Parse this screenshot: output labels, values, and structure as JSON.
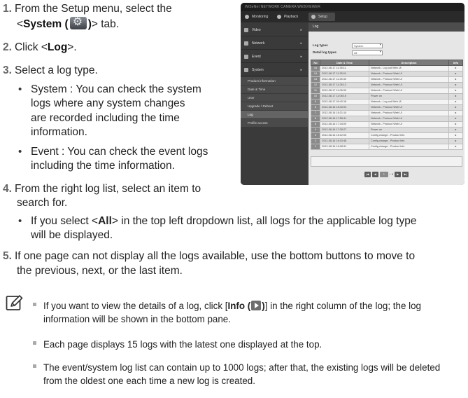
{
  "steps": [
    {
      "num": "1.",
      "line1": "From the Setup menu, select the",
      "pre": "<",
      "bold": "System (",
      "bold2": ")",
      "post": "> tab."
    },
    {
      "num": "2.",
      "pre": "Click <",
      "bold": "Log",
      "post": ">."
    },
    {
      "num": "3.",
      "text": "Select a log type."
    },
    {
      "num": "4.",
      "line1": "From the right log list, select an item to",
      "line2": "search for."
    },
    {
      "num": "5.",
      "line1": "If one page can not display all the logs available, use the bottom buttons to move to",
      "line2": "the previous, next, or the last item."
    }
  ],
  "sub_bullets": [
    {
      "l1": "System : You can check the system",
      "l2": "logs where any system changes",
      "l3": "are recorded including the time",
      "l4": "information."
    },
    {
      "l1": "Event : You can check the event logs",
      "l2": "including the time information."
    },
    {
      "pre": "If you select <",
      "bold": "All",
      "post": "> in the top left dropdown list, all logs for the applicable log type",
      "l2": "will be displayed."
    }
  ],
  "notes": [
    {
      "pre": "If you want to view the details of a log, click [",
      "bold": "Info (",
      "bold2": ")",
      "post": "] in the right column of the log; the log",
      "l2": "information will be shown in the bottom pane."
    },
    {
      "text": "Each page displays 15 logs with the latest one displayed at the top."
    },
    {
      "l1": "The event/system log list can contain up to 1000 logs; after that, the existing logs will be deleted",
      "l2": "from the oldest one each time a new log is created."
    }
  ],
  "icons": {
    "gear": "gear-icon",
    "play": "play-icon",
    "note": "note-pencil-icon"
  },
  "screenshot": {
    "brand": "WiSeNet NETWORK CAMERA WEBVIEWER",
    "nav": [
      "Monitoring",
      "Playback",
      "Setup"
    ],
    "sidebar": [
      "Video",
      "Network",
      "Event",
      "System"
    ],
    "submenu": [
      "Product information",
      "Date & Time",
      "User",
      "Upgrade / Reboot",
      "Log",
      "Profile access"
    ],
    "panel_title": "Log",
    "filters": [
      {
        "label": "Log types",
        "value": "System"
      },
      {
        "label": "Detail log types",
        "value": "All"
      }
    ],
    "columns": [
      "No",
      "Date & Time",
      "Description",
      "Info"
    ],
    "rows": [
      {
        "no": "15",
        "date": "2012-08-17 11:35:11",
        "desc": "Network - Log out Web UI"
      },
      {
        "no": "14",
        "date": "2012-08-17 11:35:01",
        "desc": "Network - Protocol Web UI"
      },
      {
        "no": "13",
        "date": "2012-08-17 11:26:40",
        "desc": "Network - Protocol Web UI"
      },
      {
        "no": "12",
        "date": "2012-08-17 11:26:12",
        "desc": "Network - Protocol Web UI"
      },
      {
        "no": "11",
        "date": "2012-08-17 11:08:33",
        "desc": "Network - Protocol Web UI"
      },
      {
        "no": "10",
        "date": "2012-08-17 11:08:15",
        "desc": "Power on"
      },
      {
        "no": "9",
        "date": "2012-08-17 09:42:18",
        "desc": "Network - Log out Web UI"
      },
      {
        "no": "8",
        "date": "2012-08-16 18:40:03",
        "desc": "Network - Protocol Web UI"
      },
      {
        "no": "7",
        "date": "2012-08-16 18:21:10",
        "desc": "Network - Protocol Web UI"
      },
      {
        "no": "6",
        "date": "2012-08-16 17:55:41",
        "desc": "Network - Protocol Web UI"
      },
      {
        "no": "5",
        "date": "2012-08-16 17:34:09",
        "desc": "Network - Protocol Web UI"
      },
      {
        "no": "4",
        "date": "2012-08-16 17:30:27",
        "desc": "Power on"
      },
      {
        "no": "3",
        "date": "2012-08-16 16:12:05",
        "desc": "Config change - Product Info"
      },
      {
        "no": "2",
        "date": "2012-08-16 16:10:48",
        "desc": "Config change - Product Info"
      },
      {
        "no": "1",
        "date": "2012-08-16 16:08:31",
        "desc": "Config change - Product Info"
      }
    ],
    "pager": {
      "first": "|◀",
      "prev": "◀",
      "current": "1",
      "sep": "/",
      "total": "5",
      "next": "▶",
      "last": "▶|"
    }
  }
}
